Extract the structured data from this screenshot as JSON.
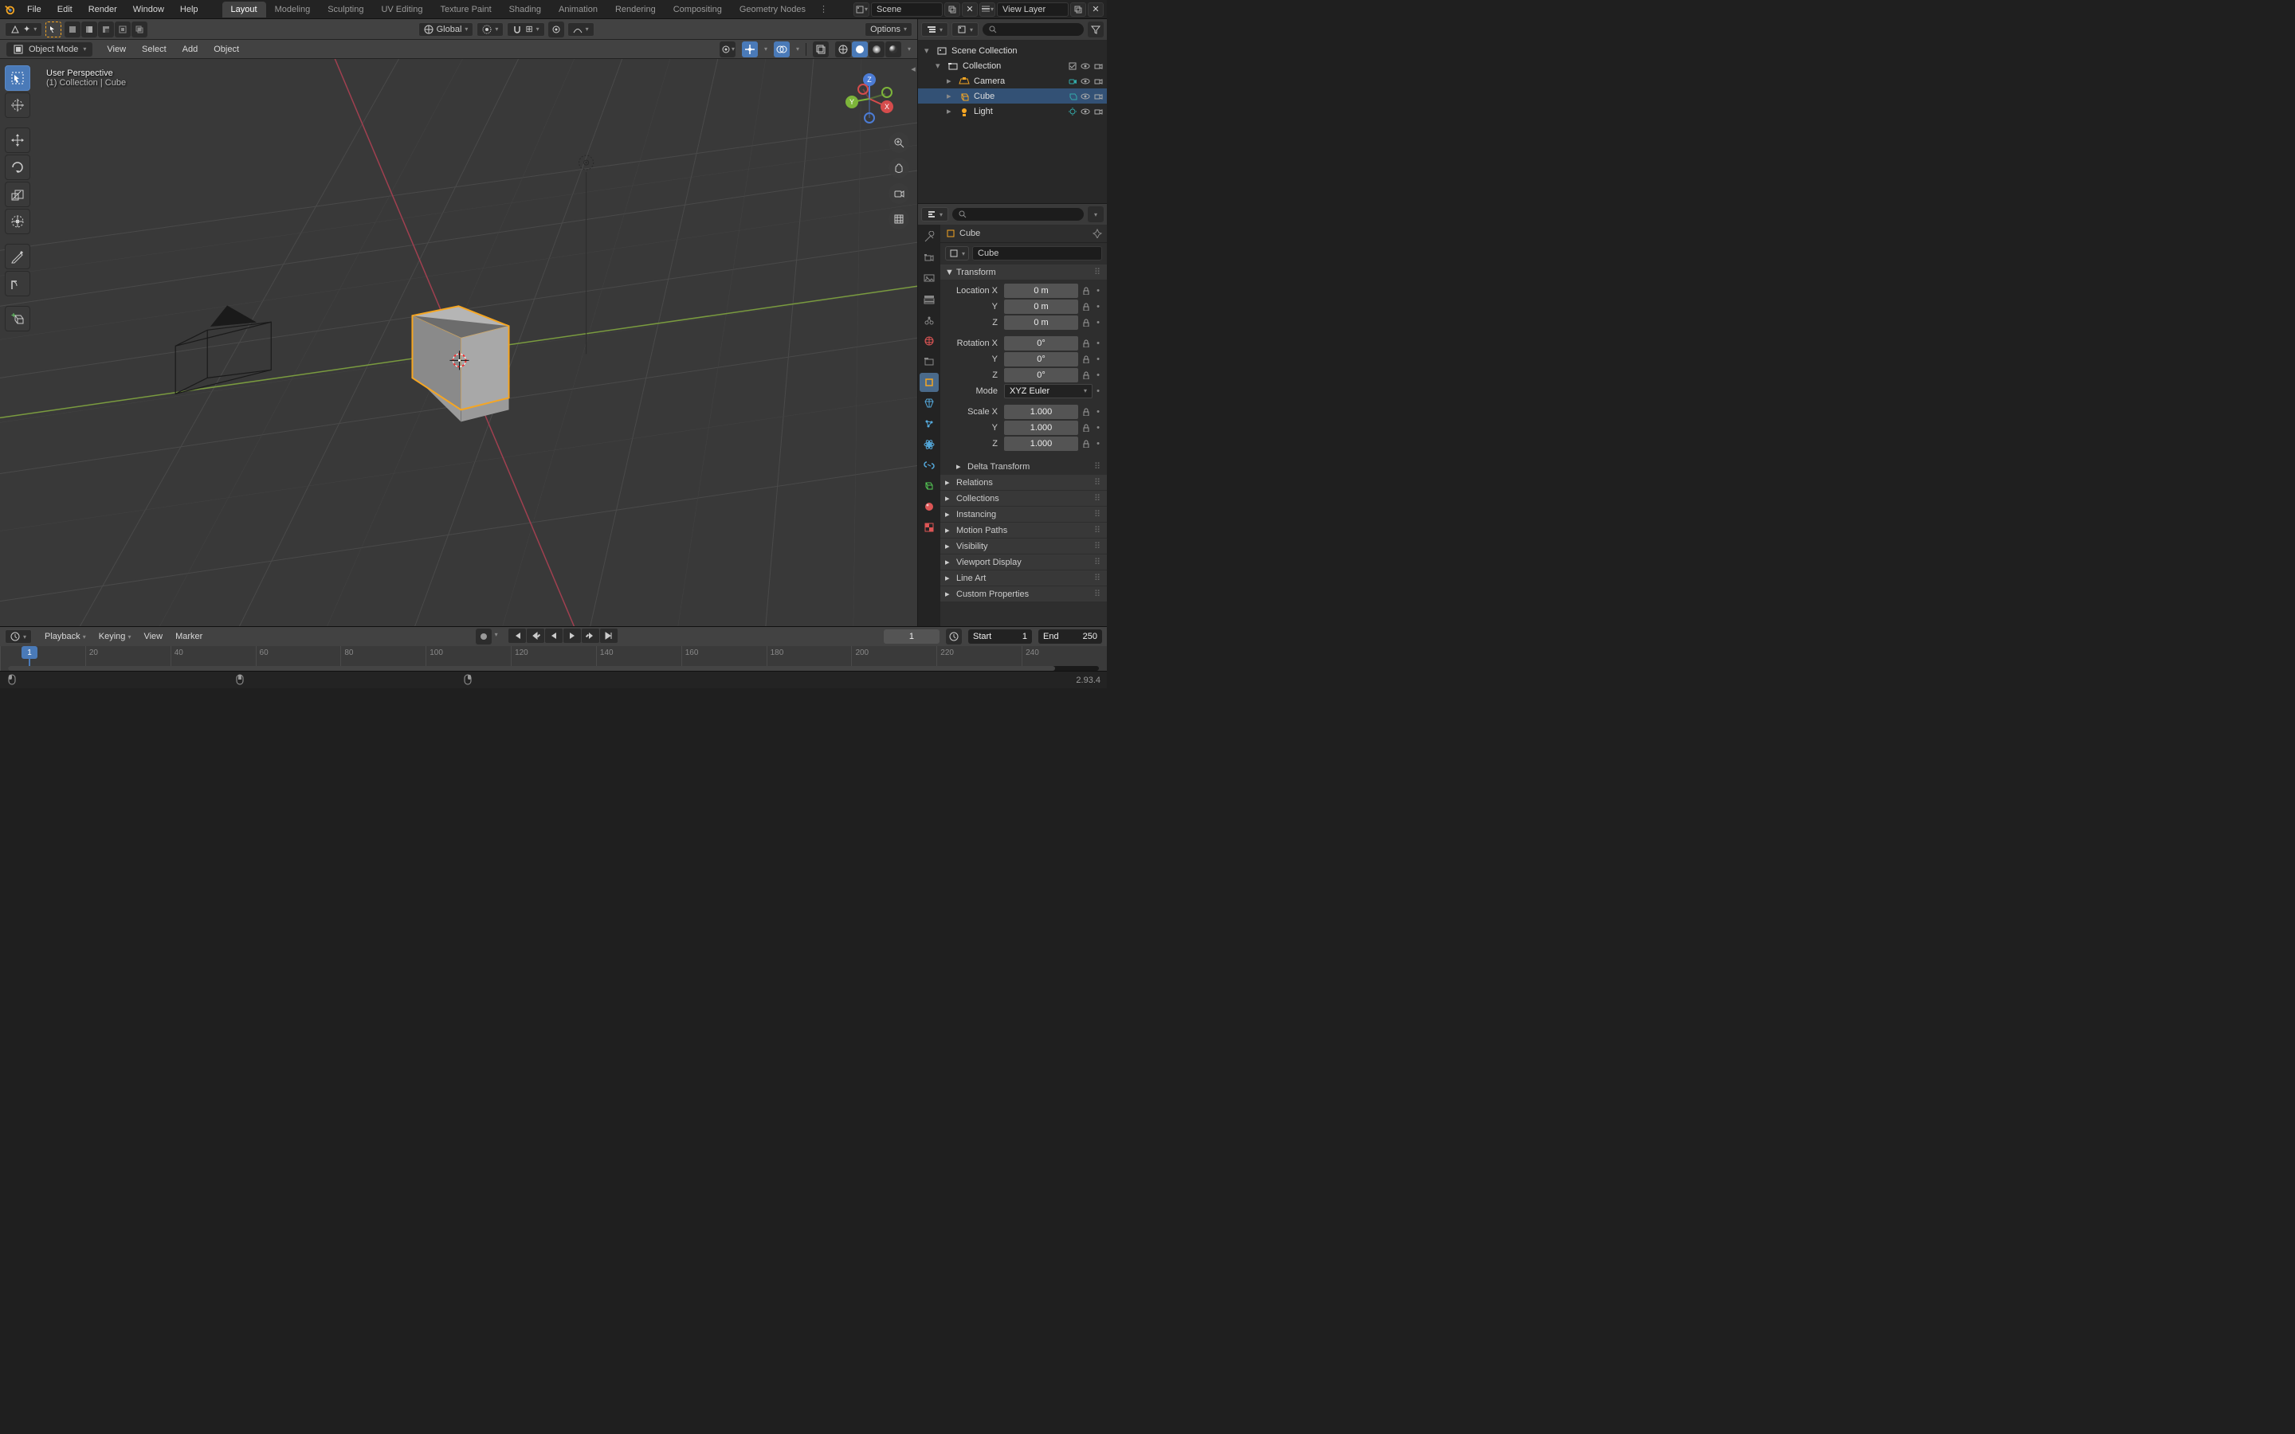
{
  "menu": [
    "File",
    "Edit",
    "Render",
    "Window",
    "Help"
  ],
  "workspaces": [
    "Layout",
    "Modeling",
    "Sculpting",
    "UV Editing",
    "Texture Paint",
    "Shading",
    "Animation",
    "Rendering",
    "Compositing",
    "Geometry Nodes"
  ],
  "active_workspace": "Layout",
  "scene_name": "Scene",
  "view_layer": "View Layer",
  "vp": {
    "orientation": "Global",
    "options": "Options",
    "mode": "Object Mode",
    "menus": [
      "View",
      "Select",
      "Add",
      "Object"
    ],
    "info1": "User Perspective",
    "info2": "(1) Collection | Cube"
  },
  "outliner": {
    "root": "Scene Collection",
    "collection": "Collection",
    "items": [
      "Camera",
      "Cube",
      "Light"
    ],
    "selected": "Cube"
  },
  "props": {
    "crumb": "Cube",
    "name": "Cube",
    "transform": {
      "title": "Transform",
      "loc_label": "Location X",
      "rot_label": "Rotation X",
      "scale_label": "Scale X",
      "mode_label": "Mode",
      "loc": [
        "0 m",
        "0 m",
        "0 m"
      ],
      "rot": [
        "0°",
        "0°",
        "0°"
      ],
      "scale": [
        "1.000",
        "1.000",
        "1.000"
      ],
      "mode": "XYZ Euler"
    },
    "panels": [
      "Delta Transform",
      "Relations",
      "Collections",
      "Instancing",
      "Motion Paths",
      "Visibility",
      "Viewport Display",
      "Line Art",
      "Custom Properties"
    ]
  },
  "timeline": {
    "menus": [
      "Playback",
      "Keying",
      "View",
      "Marker"
    ],
    "current": 1,
    "start_label": "Start",
    "start": 1,
    "end_label": "End",
    "end": 250,
    "ticks": [
      20,
      40,
      60,
      80,
      100,
      120,
      140,
      160,
      180,
      200,
      220,
      240
    ]
  },
  "version": "2.93.4"
}
